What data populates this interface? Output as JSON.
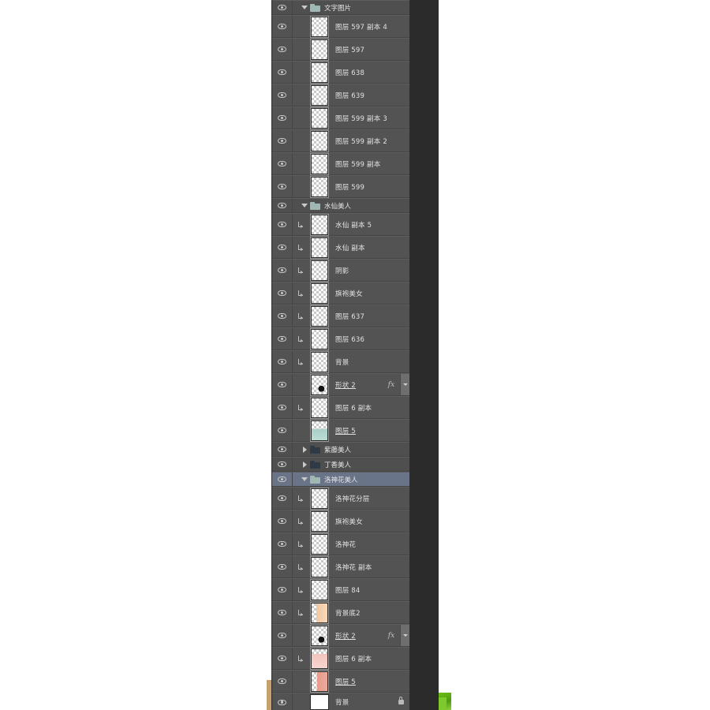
{
  "panel": {
    "name": "photoshop-layers-panel",
    "background_color": "#535353",
    "selected_row_color": "#6a7489"
  },
  "rows": [
    {
      "kind": "group",
      "expanded": true,
      "name": "文字图片",
      "selected": false,
      "visible": true
    },
    {
      "kind": "layer",
      "name": "图层 597 副本 4",
      "thumb": "transparent",
      "clip": false,
      "visible": true
    },
    {
      "kind": "layer",
      "name": "图层 597",
      "thumb": "transparent",
      "clip": false,
      "visible": true
    },
    {
      "kind": "layer",
      "name": "图层 638",
      "thumb": "transparent",
      "clip": false,
      "visible": true
    },
    {
      "kind": "layer",
      "name": "图层 639",
      "thumb": "transparent",
      "clip": false,
      "visible": true
    },
    {
      "kind": "layer",
      "name": "图层 599 副本 3",
      "thumb": "transparent",
      "clip": false,
      "visible": true
    },
    {
      "kind": "layer",
      "name": "图层 599 副本 2",
      "thumb": "transparent",
      "clip": false,
      "visible": true
    },
    {
      "kind": "layer",
      "name": "图层 599 副本",
      "thumb": "transparent",
      "clip": false,
      "visible": true
    },
    {
      "kind": "layer",
      "name": "图层 599",
      "thumb": "transparent",
      "clip": false,
      "visible": true
    },
    {
      "kind": "group",
      "expanded": true,
      "name": "水仙美人",
      "selected": false,
      "visible": true
    },
    {
      "kind": "layer",
      "name": "水仙 副本 5",
      "thumb": "transparent",
      "clip": true,
      "visible": true
    },
    {
      "kind": "layer",
      "name": "水仙 副本",
      "thumb": "transparent",
      "clip": true,
      "visible": true
    },
    {
      "kind": "layer",
      "name": "阴影",
      "thumb": "transparent",
      "clip": true,
      "visible": true
    },
    {
      "kind": "layer",
      "name": "旗袍美女",
      "thumb": "transparent",
      "clip": true,
      "visible": true
    },
    {
      "kind": "layer",
      "name": "图层 637",
      "thumb": "transparent",
      "clip": true,
      "visible": true
    },
    {
      "kind": "layer",
      "name": "图层 636",
      "thumb": "transparent",
      "clip": true,
      "visible": true
    },
    {
      "kind": "layer",
      "name": "背景",
      "thumb": "transparent",
      "clip": true,
      "visible": true
    },
    {
      "kind": "layer",
      "name": "形状 2",
      "thumb": "shape-dot",
      "clip": false,
      "visible": true,
      "fx": "fx",
      "underline": true
    },
    {
      "kind": "layer",
      "name": "图层 6 副本",
      "thumb": "transparent",
      "clip": true,
      "visible": true
    },
    {
      "kind": "layer",
      "name": "图层 5",
      "thumb": "teal",
      "clip": false,
      "visible": true,
      "underline": true
    },
    {
      "kind": "group",
      "expanded": false,
      "name": "紫藤美人",
      "selected": false,
      "visible": true
    },
    {
      "kind": "group",
      "expanded": false,
      "name": "丁香美人",
      "selected": false,
      "visible": true
    },
    {
      "kind": "group",
      "expanded": true,
      "name": "洛神花美人",
      "selected": true,
      "visible": true
    },
    {
      "kind": "layer",
      "name": "洛神花分层",
      "thumb": "transparent",
      "clip": true,
      "visible": true
    },
    {
      "kind": "layer",
      "name": "旗袍美女",
      "thumb": "transparent",
      "clip": true,
      "visible": true
    },
    {
      "kind": "layer",
      "name": "洛神花",
      "thumb": "transparent",
      "clip": true,
      "visible": true
    },
    {
      "kind": "layer",
      "name": "洛神花 副本",
      "thumb": "transparent",
      "clip": true,
      "visible": true
    },
    {
      "kind": "layer",
      "name": "图层 84",
      "thumb": "transparent",
      "clip": true,
      "visible": true
    },
    {
      "kind": "layer",
      "name": "背景底2",
      "thumb": "peach",
      "clip": true,
      "visible": true
    },
    {
      "kind": "layer",
      "name": "形状 2",
      "thumb": "shape-dot",
      "clip": false,
      "visible": true,
      "fx": "fx",
      "underline": true
    },
    {
      "kind": "layer",
      "name": "图层 6 副本",
      "thumb": "pink",
      "clip": true,
      "visible": true
    },
    {
      "kind": "layer",
      "name": "图层 5",
      "thumb": "salmon",
      "clip": false,
      "visible": true,
      "underline": true
    },
    {
      "kind": "layer",
      "name": "背景",
      "thumb": "white",
      "clip": false,
      "visible": true,
      "locked": true,
      "bottom": true
    }
  ],
  "icons": {
    "eye": "eye-icon",
    "folder_open": "folder-open-icon",
    "folder_closed": "folder-closed-icon",
    "triangle_down": "chevron-down-icon",
    "triangle_right": "chevron-right-icon",
    "clip": "clipping-mask-icon",
    "effects": "fx-icon",
    "effects_caret": "fx-expand-caret-icon",
    "lock": "lock-icon"
  }
}
